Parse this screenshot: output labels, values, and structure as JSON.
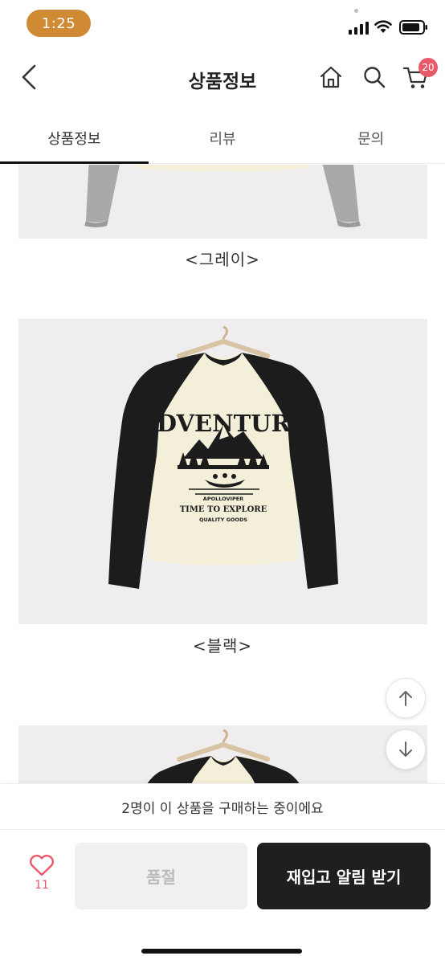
{
  "status_bar": {
    "time": "1:25",
    "time_bg": "#cf8a33"
  },
  "header": {
    "title": "상품정보",
    "cart_count": "20",
    "badge_color": "#e8596a"
  },
  "tabs": [
    {
      "label": "상품정보",
      "active": true
    },
    {
      "label": "리뷰",
      "active": false
    },
    {
      "label": "문의",
      "active": false
    }
  ],
  "product_images": [
    {
      "caption": "<그레이>",
      "sleeve_color": "#a9a9ab"
    },
    {
      "caption": "<블랙>",
      "sleeve_color": "#1c1c1c",
      "print_text": "ADVENTURE"
    },
    {
      "caption": "",
      "sleeve_color": "#1c1c1c"
    }
  ],
  "tee_print": {
    "brand": "APOLLOVIPER",
    "slogan": "TIME TO EXPLORE",
    "sub": "QUALITY GOODS"
  },
  "notice": {
    "text": "2명이 이 상품을 구매하는 중이에요"
  },
  "actions": {
    "like_count": "11",
    "soldout_label": "품절",
    "restock_label": "재입고 알림 받기"
  },
  "colors": {
    "accent_pink": "#e8596a",
    "tee_body": "#f4efd9",
    "dark_button": "#1f1f1f"
  }
}
